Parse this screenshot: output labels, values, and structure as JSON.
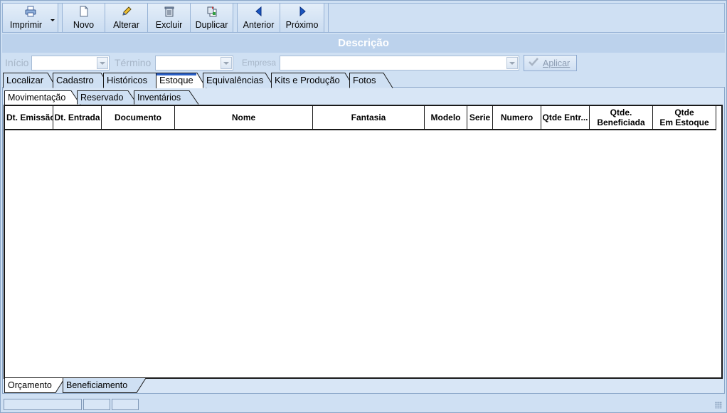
{
  "toolbar": {
    "imprimir": "Imprimir",
    "novo": "Novo",
    "alterar": "Alterar",
    "excluir": "Excluir",
    "duplicar": "Duplicar",
    "anterior": "Anterior",
    "proximo": "Próximo"
  },
  "banner": "Descrição",
  "filters": {
    "inicio_label": "Início",
    "termino_label": "Término",
    "empresa_label": "Empresa",
    "inicio_value": "",
    "termino_value": "",
    "empresa_value": "",
    "aplicar": "Aplicar"
  },
  "tabs": [
    "Localizar",
    "Cadastro",
    "Históricos",
    "Estoque",
    "Equivalências",
    "Kits e Produção",
    "Fotos"
  ],
  "active_tab": "Estoque",
  "subtabs": [
    "Movimentação",
    "Reservado",
    "Inventários"
  ],
  "active_subtab": "Movimentação",
  "columns": [
    "Dt. Emissão",
    "Dt. Entrada",
    "Documento",
    "Nome",
    "Fantasia",
    "Modelo",
    "Serie",
    "Numero",
    "Qtde Entr...",
    "Qtde.\nBeneficiada",
    "Qtde\nEm Estoque"
  ],
  "bottom_tabs": [
    "Orçamento",
    "Beneficiamento"
  ],
  "active_bottom_tab": "Orçamento",
  "colors": {
    "window_bg": "#cfe0f3",
    "tab_active": "#ffffff",
    "tab_inactive": "#cfe0f3",
    "banner_bg": "#bcd2ec"
  }
}
